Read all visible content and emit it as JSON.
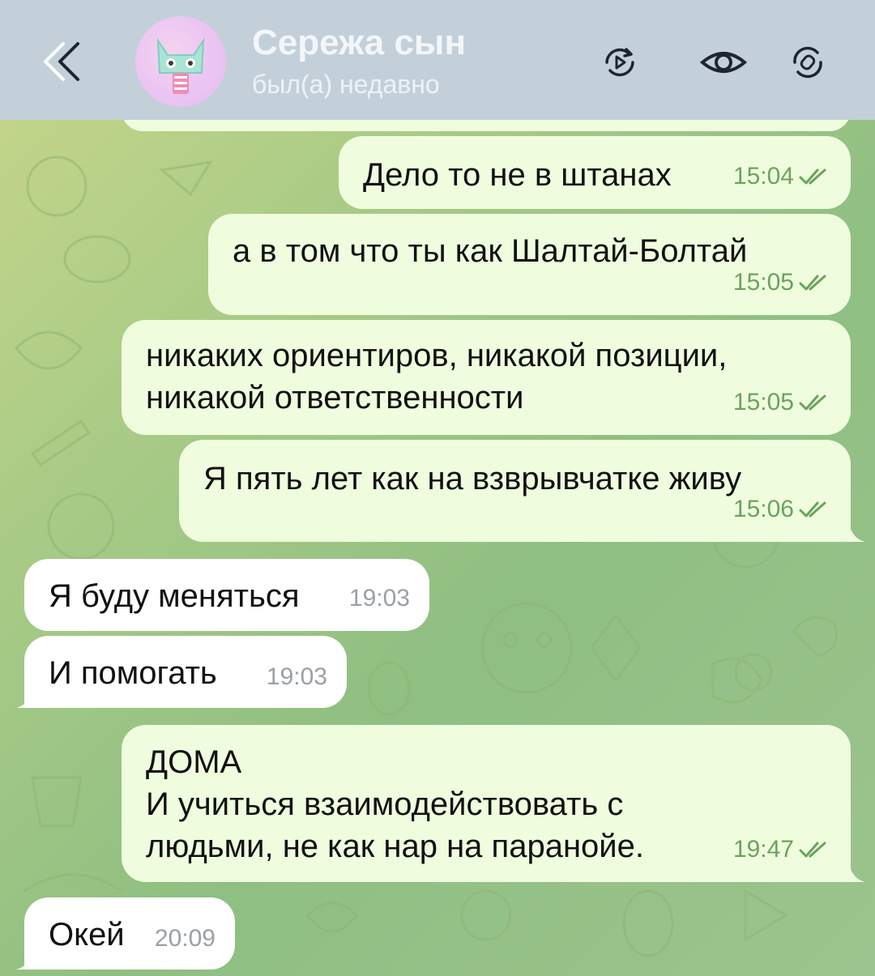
{
  "header": {
    "back_icon": "double-chevron-left-icon",
    "contact_name": "Сережа сын",
    "status": "был(а) недавно",
    "actions": [
      {
        "icon": "video-call-icon"
      },
      {
        "icon": "eye-icon"
      },
      {
        "icon": "rotate-sticker-icon"
      }
    ]
  },
  "messages": [
    {
      "direction": "out",
      "text": "Дело то не в штанах",
      "time": "15:04",
      "read": true
    },
    {
      "direction": "out",
      "text": "а в том  что ты как Шалтай-Болтай",
      "time": "15:05",
      "read": true
    },
    {
      "direction": "out",
      "text": "никаких ориентиров, никакой позиции,\nникакой ответственности",
      "time": "15:05",
      "read": true
    },
    {
      "direction": "out",
      "text": "Я пять лет как на взврывчатке живу",
      "time": "15:06",
      "read": true
    },
    {
      "direction": "in",
      "text": "Я буду меняться",
      "time": "19:03"
    },
    {
      "direction": "in",
      "text": "И помогать",
      "time": "19:03"
    },
    {
      "direction": "out",
      "text": "ДОМА\nИ учиться взаимодействовать с\nлюдьми, не как нар на паранойе.",
      "time": "19:47",
      "read": true
    },
    {
      "direction": "in",
      "text": "Окей",
      "time": "20:09"
    }
  ],
  "colors": {
    "header_bg": "#c3d0da",
    "outgoing_bubble": "#effdde",
    "incoming_bubble": "#ffffff",
    "outgoing_meta": "#6ca25e",
    "incoming_meta": "#9aa0a6"
  }
}
